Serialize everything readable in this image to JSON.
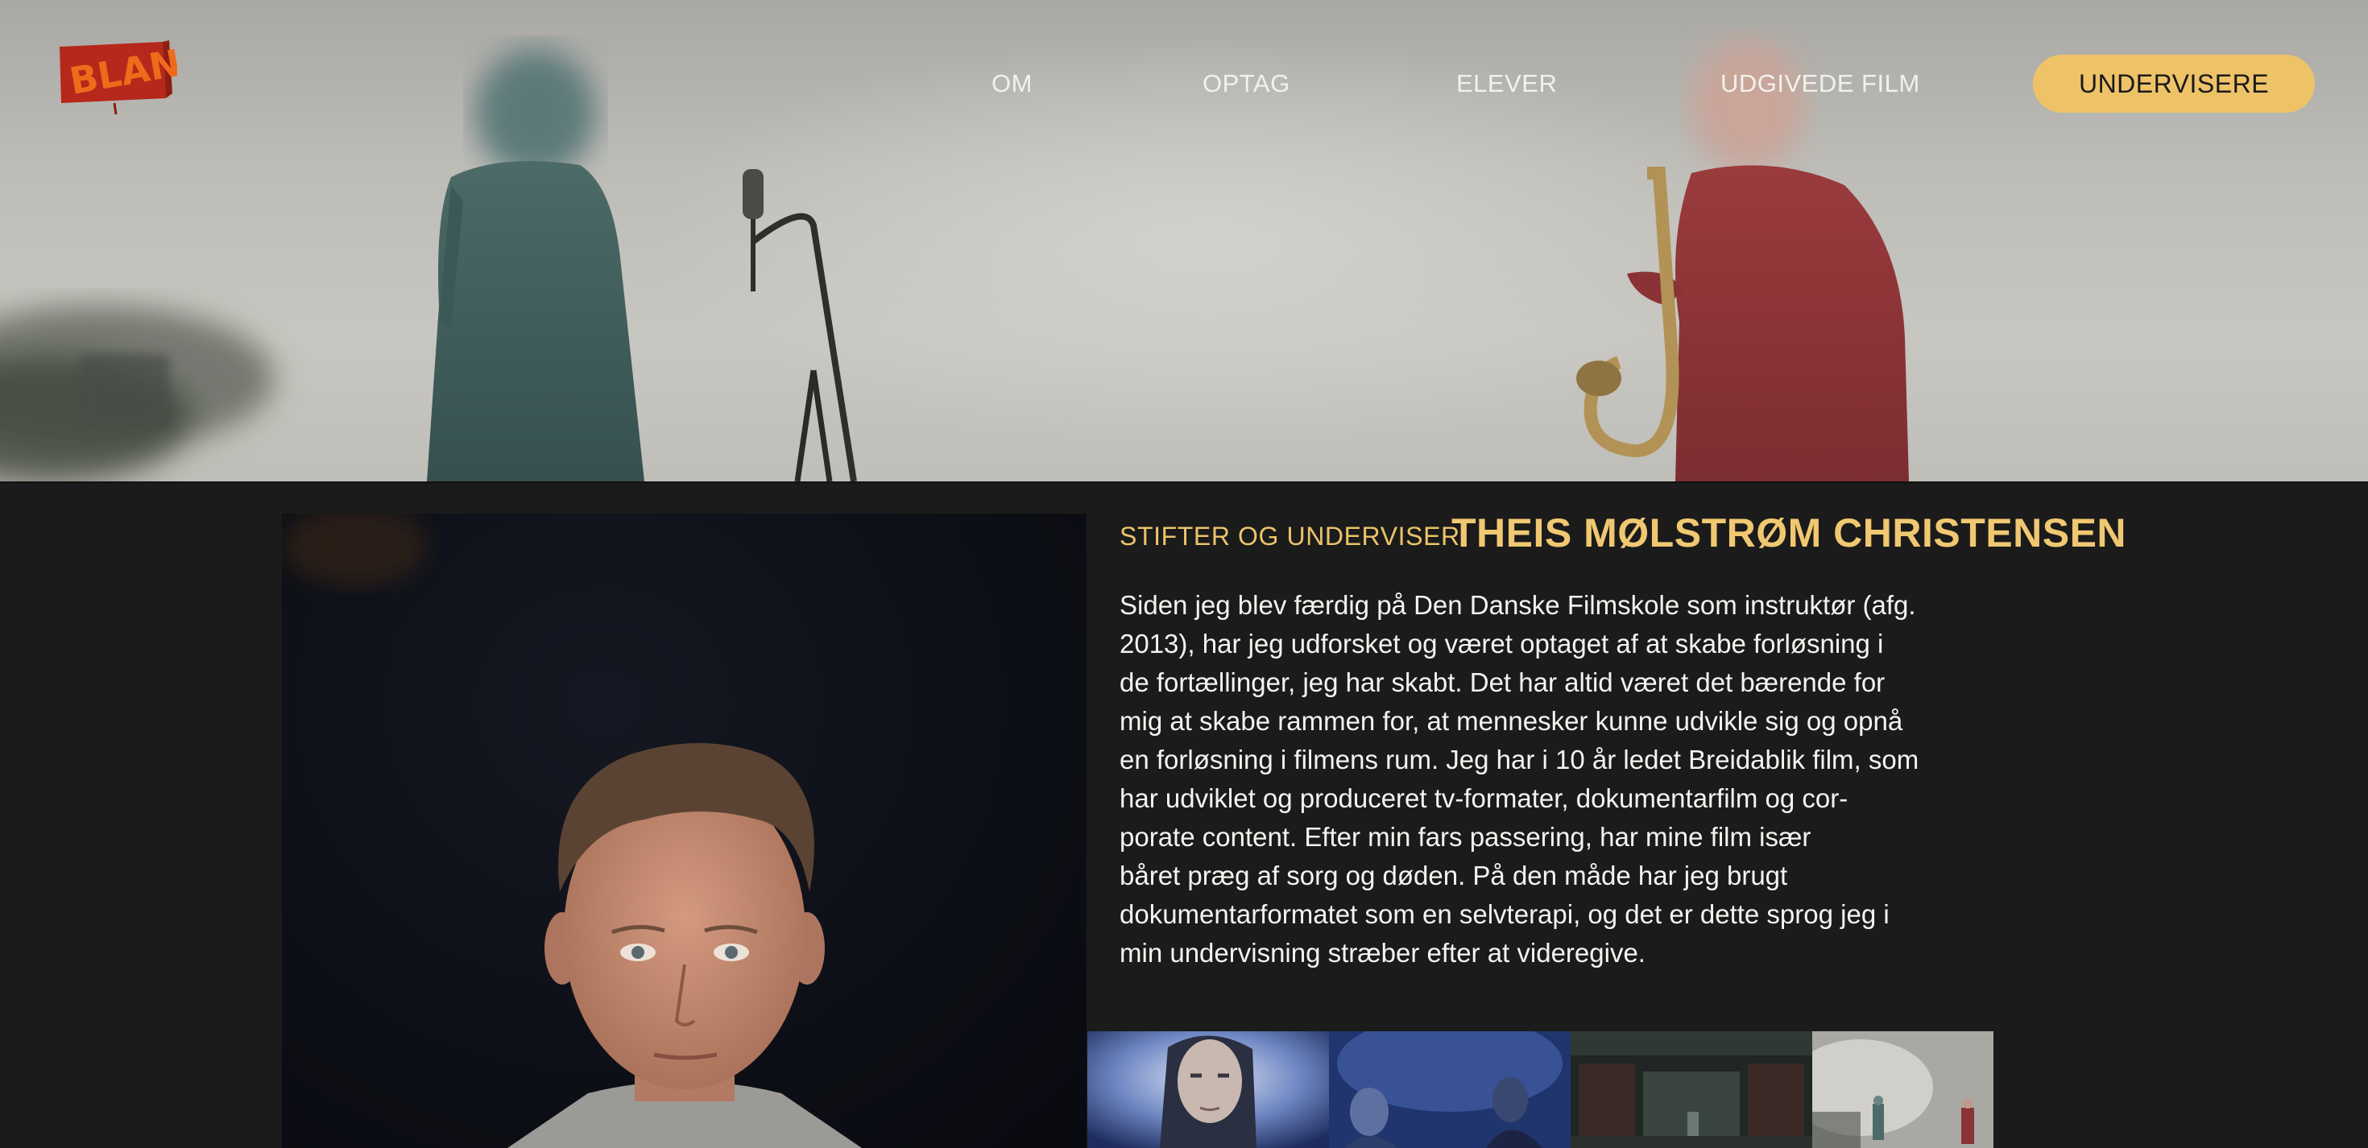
{
  "brand": {
    "logo_text": "BLANK",
    "accent": "#eec368",
    "logo_red": "#b5281b"
  },
  "nav": {
    "items": [
      {
        "label": "OM"
      },
      {
        "label": "OPTAG"
      },
      {
        "label": "ELEVER"
      },
      {
        "label": "UDGIVEDE FILM"
      }
    ],
    "cta_label": "UNDERVISERE"
  },
  "teacher": {
    "role": "STIFTER OG UNDERVISER",
    "name": "THEIS MØLSTRØM CHRISTENSEN",
    "bio_lines": [
      "Siden jeg blev færdig på Den Danske Filmskole som instruktør (afg.",
      "2013), har jeg udforsket og været optaget af at skabe forløsning i",
      "de fortællinger, jeg har skabt. Det har altid været det bærende for",
      "mig at skabe rammen for, at mennesker kunne udvikle sig og opnå",
      "en forløsning i filmens rum. Jeg har i 10 år ledet Breidablik film, som",
      "har udviklet og produceret tv-formater, dokumentarfilm og cor-",
      "porate content. Efter min fars passering, har mine film især",
      "båret præg af sorg og døden. På den måde har jeg brugt",
      "dokumentarformatet som en selvterapi, og det er dette sprog jeg i",
      "min undervisning stræber efter at videregive."
    ]
  },
  "film_stills": [
    {
      "icon": "film-still-portrait-woman"
    },
    {
      "icon": "film-still-two-women-blue"
    },
    {
      "icon": "film-still-industrial-hall"
    },
    {
      "icon": "film-still-fog-figures"
    }
  ]
}
